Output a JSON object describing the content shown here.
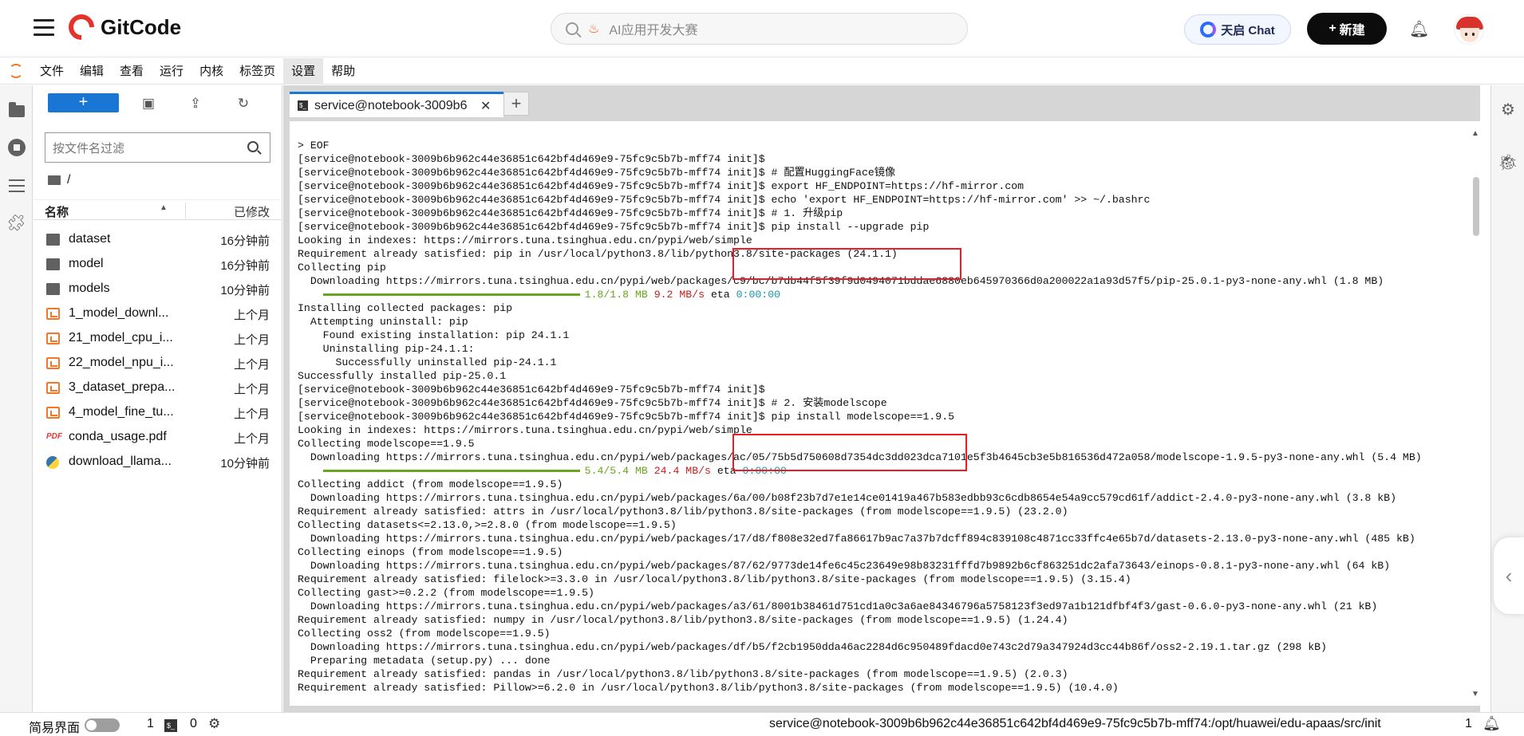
{
  "site": {
    "brand": "GitCode",
    "search_placeholder": "AI应用开发大赛",
    "chat_button": "天启 Chat",
    "new_button": "新建",
    "new_plus": "+"
  },
  "menu": {
    "items": [
      "文件",
      "编辑",
      "查看",
      "运行",
      "内核",
      "标签页",
      "设置",
      "帮助"
    ],
    "active": "设置"
  },
  "filebrowser": {
    "new_label": "+",
    "filter_placeholder": "按文件名过滤",
    "path": "/",
    "col_name": "名称",
    "col_modified": "已修改",
    "files": [
      {
        "name": "dataset",
        "modified": "16分钟前",
        "type": "folder"
      },
      {
        "name": "model",
        "modified": "16分钟前",
        "type": "folder"
      },
      {
        "name": "models",
        "modified": "10分钟前",
        "type": "folder"
      },
      {
        "name": "1_model_downl...",
        "modified": "上个月",
        "type": "notebook"
      },
      {
        "name": "21_model_cpu_i...",
        "modified": "上个月",
        "type": "notebook"
      },
      {
        "name": "22_model_npu_i...",
        "modified": "上个月",
        "type": "notebook"
      },
      {
        "name": "3_dataset_prepa...",
        "modified": "上个月",
        "type": "notebook"
      },
      {
        "name": "4_model_fine_tu...",
        "modified": "上个月",
        "type": "notebook"
      },
      {
        "name": "conda_usage.pdf",
        "modified": "上个月",
        "type": "pdf"
      },
      {
        "name": "download_llama...",
        "modified": "10分钟前",
        "type": "python"
      }
    ]
  },
  "tab": {
    "title": "service@notebook-3009b6",
    "close": "✕",
    "add": "+"
  },
  "terminal": {
    "lines": [
      "> EOF",
      "[service@notebook-3009b6b962c44e36851c642bf4d469e9-75fc9c5b7b-mff74 init]$",
      "[service@notebook-3009b6b962c44e36851c642bf4d469e9-75fc9c5b7b-mff74 init]$ # 配置HuggingFace镜像",
      "[service@notebook-3009b6b962c44e36851c642bf4d469e9-75fc9c5b7b-mff74 init]$ export HF_ENDPOINT=https://hf-mirror.com",
      "[service@notebook-3009b6b962c44e36851c642bf4d469e9-75fc9c5b7b-mff74 init]$ echo 'export HF_ENDPOINT=https://hf-mirror.com' >> ~/.bashrc",
      "[service@notebook-3009b6b962c44e36851c642bf4d469e9-75fc9c5b7b-mff74 init]$ # 1. 升级pip",
      "[service@notebook-3009b6b962c44e36851c642bf4d469e9-75fc9c5b7b-mff74 init]$ pip install --upgrade pip",
      "Looking in indexes: https://mirrors.tuna.tsinghua.edu.cn/pypi/web/simple",
      "Requirement already satisfied: pip in /usr/local/python3.8/lib/python3.8/site-packages (24.1.1)",
      "Collecting pip",
      "  Downloading https://mirrors.tuna.tsinghua.edu.cn/pypi/web/packages/c9/bc/b7db44f5f39f9d0494071bddae6880eb645970366d0a200022a1a93d57f5/pip-25.0.1-py3-none-any.whl (1.8 MB)",
      "__PBAR1__",
      "Installing collected packages: pip",
      "  Attempting uninstall: pip",
      "    Found existing installation: pip 24.1.1",
      "    Uninstalling pip-24.1.1:",
      "      Successfully uninstalled pip-24.1.1",
      "Successfully installed pip-25.0.1",
      "[service@notebook-3009b6b962c44e36851c642bf4d469e9-75fc9c5b7b-mff74 init]$",
      "[service@notebook-3009b6b962c44e36851c642bf4d469e9-75fc9c5b7b-mff74 init]$ # 2. 安装modelscope",
      "[service@notebook-3009b6b962c44e36851c642bf4d469e9-75fc9c5b7b-mff74 init]$ pip install modelscope==1.9.5",
      "Looking in indexes: https://mirrors.tuna.tsinghua.edu.cn/pypi/web/simple",
      "Collecting modelscope==1.9.5",
      "  Downloading https://mirrors.tuna.tsinghua.edu.cn/pypi/web/packages/ac/05/75b5d750608d7354dc3dd023dca7101e5f3b4645cb3e5b816536d472a058/modelscope-1.9.5-py3-none-any.whl (5.4 MB)",
      "__PBAR2__",
      "Collecting addict (from modelscope==1.9.5)",
      "  Downloading https://mirrors.tuna.tsinghua.edu.cn/pypi/web/packages/6a/00/b08f23b7d7e1e14ce01419a467b583edbb93c6cdb8654e54a9cc579cd61f/addict-2.4.0-py3-none-any.whl (3.8 kB)",
      "Requirement already satisfied: attrs in /usr/local/python3.8/lib/python3.8/site-packages (from modelscope==1.9.5) (23.2.0)",
      "Collecting datasets<=2.13.0,>=2.8.0 (from modelscope==1.9.5)",
      "  Downloading https://mirrors.tuna.tsinghua.edu.cn/pypi/web/packages/17/d8/f808e32ed7fa86617b9ac7a37b7dcff894c839108c4871cc33ffc4e65b7d/datasets-2.13.0-py3-none-any.whl (485 kB)",
      "Collecting einops (from modelscope==1.9.5)",
      "  Downloading https://mirrors.tuna.tsinghua.edu.cn/pypi/web/packages/87/62/9773de14fe6c45c23649e98b83231fffd7b9892b6cf863251dc2afa73643/einops-0.8.1-py3-none-any.whl (64 kB)",
      "Requirement already satisfied: filelock>=3.3.0 in /usr/local/python3.8/lib/python3.8/site-packages (from modelscope==1.9.5) (3.15.4)",
      "Collecting gast>=0.2.2 (from modelscope==1.9.5)",
      "  Downloading https://mirrors.tuna.tsinghua.edu.cn/pypi/web/packages/a3/61/8001b38461d751cd1a0c3a6ae84346796a5758123f3ed97a1b121dfbf4f3/gast-0.6.0-py3-none-any.whl (21 kB)",
      "Requirement already satisfied: numpy in /usr/local/python3.8/lib/python3.8/site-packages (from modelscope==1.9.5) (1.24.4)",
      "Collecting oss2 (from modelscope==1.9.5)",
      "  Downloading https://mirrors.tuna.tsinghua.edu.cn/pypi/web/packages/df/b5/f2cb1950dda46ac2284d6c950489fdacd0e743c2d79a347924d3cc44b86f/oss2-2.19.1.tar.gz (298 kB)",
      "  Preparing metadata (setup.py) ... done",
      "Requirement already satisfied: pandas in /usr/local/python3.8/lib/python3.8/site-packages (from modelscope==1.9.5) (2.0.3)",
      "Requirement already satisfied: Pillow>=6.2.0 in /usr/local/python3.8/lib/python3.8/site-packages (from modelscope==1.9.5) (10.4.0)"
    ],
    "progress1": {
      "done": "1.8/1.8 MB",
      "speed": "9.2 MB/s",
      "eta_label": "eta",
      "eta": "0:00:00"
    },
    "progress2": {
      "done": "5.4/5.4 MB",
      "speed": "24.4 MB/s",
      "eta_label": "eta",
      "eta": "0:00:00"
    }
  },
  "statusbar": {
    "simple_mode": "简易界面",
    "kernels": "1",
    "terminals": "0",
    "path": "service@notebook-3009b6b962c44e36851c642bf4d469e9-75fc9c5b7b-mff74:/opt/huawei/edu-apaas/src/init",
    "notifications": "1"
  },
  "colors": {
    "accent": "#1976d2",
    "highlight_box": "#ec1c24",
    "progress_green": "#6aa51e"
  }
}
